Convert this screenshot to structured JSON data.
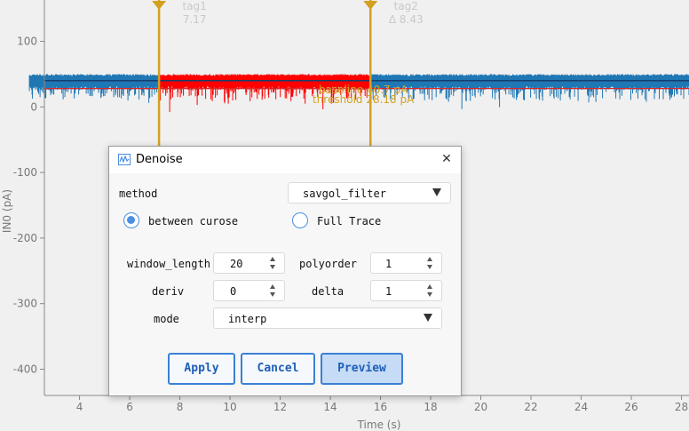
{
  "chart_data": {
    "type": "line",
    "xlabel": "Time (s)",
    "ylabel": "IN0 (pA)",
    "xlim": [
      2.6,
      28.3
    ],
    "ylim": [
      -440,
      163
    ],
    "x_ticks": [
      "4",
      "6",
      "8",
      "10",
      "12",
      "14",
      "16",
      "18",
      "20",
      "22",
      "24",
      "26",
      "28"
    ],
    "y_ticks": [
      "100",
      "0",
      "-100",
      "-200",
      "-300",
      "-400"
    ],
    "trace_color": "#1f77b4",
    "selection_color": "#ff0000",
    "threshold_color": "#d62728",
    "cursor_color": "#d4a020",
    "trace_baseline": 40,
    "threshold_value": 28,
    "cursors": [
      {
        "name": "tag1",
        "x": 7.17,
        "label": "7.17"
      },
      {
        "name": "tag2",
        "x": 15.6,
        "label": "Δ 8.43"
      }
    ],
    "annotations": [
      "baseline 40.7 pA",
      "threshold 28.18 pA"
    ]
  },
  "dialog": {
    "title": "Denoise",
    "method_label": "method",
    "method_value": "savgol_filter",
    "radio_between": "between curose",
    "radio_full": "Full Trace",
    "selected_radio": "between curose",
    "window_length_label": "window_length",
    "window_length_value": "20",
    "polyorder_label": "polyorder",
    "polyorder_value": "1",
    "deriv_label": "deriv",
    "deriv_value": "0",
    "delta_label": "delta",
    "delta_value": "1",
    "mode_label": "mode",
    "mode_value": "interp",
    "apply_label": "Apply",
    "cancel_label": "Cancel",
    "preview_label": "Preview"
  }
}
